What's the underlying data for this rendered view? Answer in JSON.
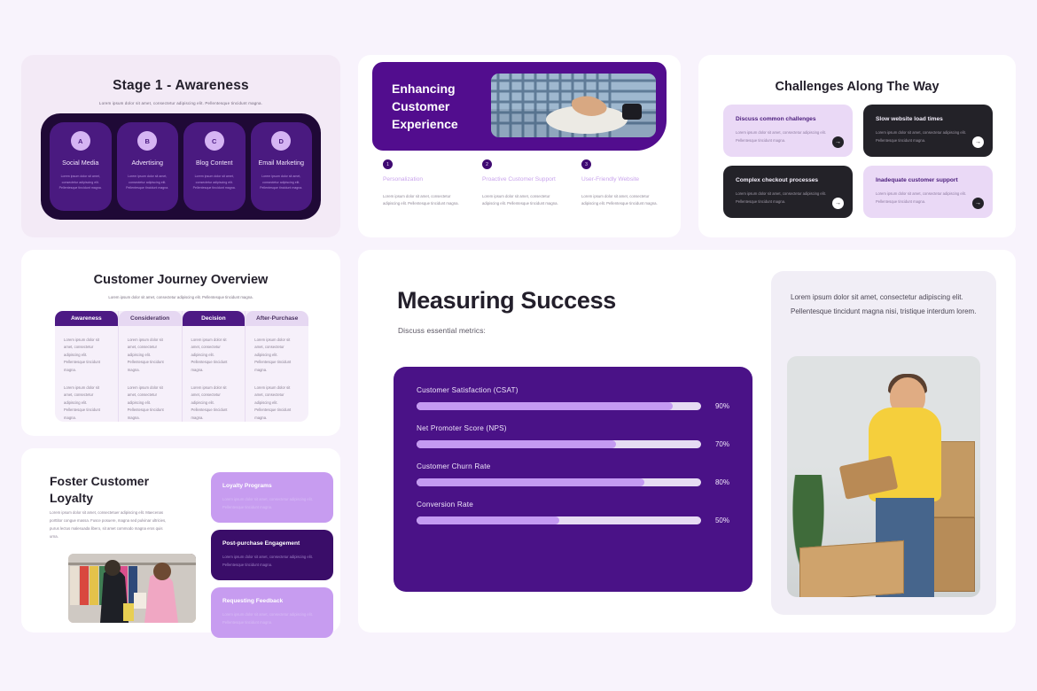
{
  "background_color": "#f8f3fc",
  "lorem_short": "Lorem ipsum dolor sit amet, consectetur adipiscing elit. Pellentesque tincidunt magna.",
  "stage1": {
    "title": "Stage 1 - Awareness",
    "subtitle": "Lorem ipsum dolor sit amet, consectetur adipiscing elit. Pellentesque tincidunt magna.",
    "items": [
      {
        "badge": "A",
        "name": "Social Media",
        "body": "Lorem ipsum dolor sit amet, consectetur adipiscing elit. Pellentesque tincidunt magna."
      },
      {
        "badge": "B",
        "name": "Advertising",
        "body": "Lorem ipsum dolor sit amet, consectetur adipiscing elit. Pellentesque tincidunt magna."
      },
      {
        "badge": "C",
        "name": "Blog Content",
        "body": "Lorem ipsum dolor sit amet, consectetur adipiscing elit. Pellentesque tincidunt magna."
      },
      {
        "badge": "D",
        "name": "Email Marketing",
        "body": "Lorem ipsum dolor sit amet, consectetur adipiscing elit. Pellentesque tincidunt magna."
      }
    ],
    "panel_color": "#1f0936",
    "tile_color": "#4a1a80",
    "badge_color": "#d5b4f3"
  },
  "enhance": {
    "title": "Enhancing Customer Experience",
    "hero_color": "#520d8e",
    "photo_alt": "hands using a tablet",
    "columns": [
      {
        "num": "1",
        "heading": "Personalization",
        "body": "Lorem ipsum dolor sit amet, consectetur adipiscing elit. Pellentesque tincidunt magna."
      },
      {
        "num": "2",
        "heading": "Proactive Customer Support",
        "body": "Lorem ipsum dolor sit amet, consectetur adipiscing elit. Pellentesque tincidunt magna."
      },
      {
        "num": "3",
        "heading": "User-Friendly Website",
        "body": "Lorem ipsum dolor sit amet, consectetur adipiscing elit. Pellentesque tincidunt magna."
      }
    ]
  },
  "challenges": {
    "title": "Challenges Along The Way",
    "items": [
      {
        "title": "Discuss common challenges",
        "body": "Lorem ipsum dolor sit amet, consectetur adipiscing elit. Pellentesque tincidunt magna.",
        "theme": "light",
        "arrow": "→"
      },
      {
        "title": "Slow website load times",
        "body": "Lorem ipsum dolor sit amet, consectetur adipiscing elit. Pellentesque tincidunt magna.",
        "theme": "dark",
        "arrow": "→"
      },
      {
        "title": "Complex checkout processes",
        "body": "Lorem ipsum dolor sit amet, consectetur adipiscing elit. Pellentesque tincidunt magna.",
        "theme": "dark",
        "arrow": "→"
      },
      {
        "title": "Inadequate customer support",
        "body": "Lorem ipsum dolor sit amet, consectetur adipiscing elit. Pellentesque tincidunt magna.",
        "theme": "light",
        "arrow": "→"
      }
    ]
  },
  "journey": {
    "title": "Customer Journey Overview",
    "subtitle": "Lorem ipsum dolor sit amet, consectetur adipiscing elit. Pellentesque tincidunt magna.",
    "columns": [
      {
        "header": "Awareness",
        "theme": "dark",
        "cells": [
          "Lorem ipsum dolor sit amet, consectetur adipiscing elit. Pellentesque tincidunt magna.",
          "Lorem ipsum dolor sit amet, consectetur adipiscing elit. Pellentesque tincidunt magna."
        ]
      },
      {
        "header": "Consideration",
        "theme": "light",
        "cells": [
          "Lorem ipsum dolor sit amet, consectetur adipiscing elit. Pellentesque tincidunt magna.",
          "Lorem ipsum dolor sit amet, consectetur adipiscing elit. Pellentesque tincidunt magna."
        ]
      },
      {
        "header": "Decision",
        "theme": "dark",
        "cells": [
          "Lorem ipsum dolor sit amet, consectetur adipiscing elit. Pellentesque tincidunt magna.",
          "Lorem ipsum dolor sit amet, consectetur adipiscing elit. Pellentesque tincidunt magna."
        ]
      },
      {
        "header": "After-Purchase",
        "theme": "light",
        "cells": [
          "Lorem ipsum dolor sit amet, consectetur adipiscing elit. Pellentesque tincidunt magna.",
          "Lorem ipsum dolor sit amet, consectetur adipiscing elit. Pellentesque tincidunt magna."
        ]
      }
    ]
  },
  "foster": {
    "title": "Foster Customer Loyalty",
    "body": "Lorem ipsum dolor sit amet, consectetuer adipiscing elit. Maecenas porttitor congue massa. Fusce posuere, magna sed pulvinar ultricies, purus lectus malesuada libero, sit amet commodo magna eros quis urna.",
    "photo_alt": "two women shopping at a clothing rack",
    "items": [
      {
        "title": "Loyalty Programs",
        "body": "Lorem ipsum dolor sit amet, consectetur adipiscing elit. Pellentesque tincidunt magna.",
        "theme": "lilac"
      },
      {
        "title": "Post-purchase Engagement",
        "body": "Lorem ipsum dolor sit amet, consectetur adipiscing elit. Pellentesque tincidunt magna.",
        "theme": "deep"
      },
      {
        "title": "Requesting Feedback",
        "body": "Lorem ipsum dolor sit amet, consectetur adipiscing elit. Pellentesque tincidunt magna.",
        "theme": "lilac"
      }
    ]
  },
  "measure": {
    "title": "Measuring Success",
    "subtitle": "Discuss essential metrics:",
    "panel_color": "#4a1287",
    "fill_color": "#c49af2",
    "track_color": "#e6dbf3",
    "side_text": "Lorem ipsum dolor sit amet, consectetur adipiscing elit. Pellentesque tincidunt magna nisi, tristique interdum lorem.",
    "side_photo_alt": "man in yellow t-shirt holding a clipboard beside cardboard boxes"
  },
  "chart_data": {
    "type": "bar",
    "title": "Measuring Success",
    "subtitle": "Discuss essential metrics:",
    "orientation": "horizontal",
    "categories": [
      "Customer Satisfaction (CSAT)",
      "Net Promoter Score (NPS)",
      "Customer Churn Rate",
      "Conversion Rate"
    ],
    "values": [
      90,
      70,
      80,
      50
    ],
    "value_labels": [
      "90%",
      "70%",
      "80%",
      "50%"
    ],
    "xlabel": "",
    "ylabel": "",
    "ylim": [
      0,
      100
    ],
    "grid": false,
    "legend": "none",
    "bar_color": "#c49af2",
    "track_color": "#e6dbf3"
  }
}
